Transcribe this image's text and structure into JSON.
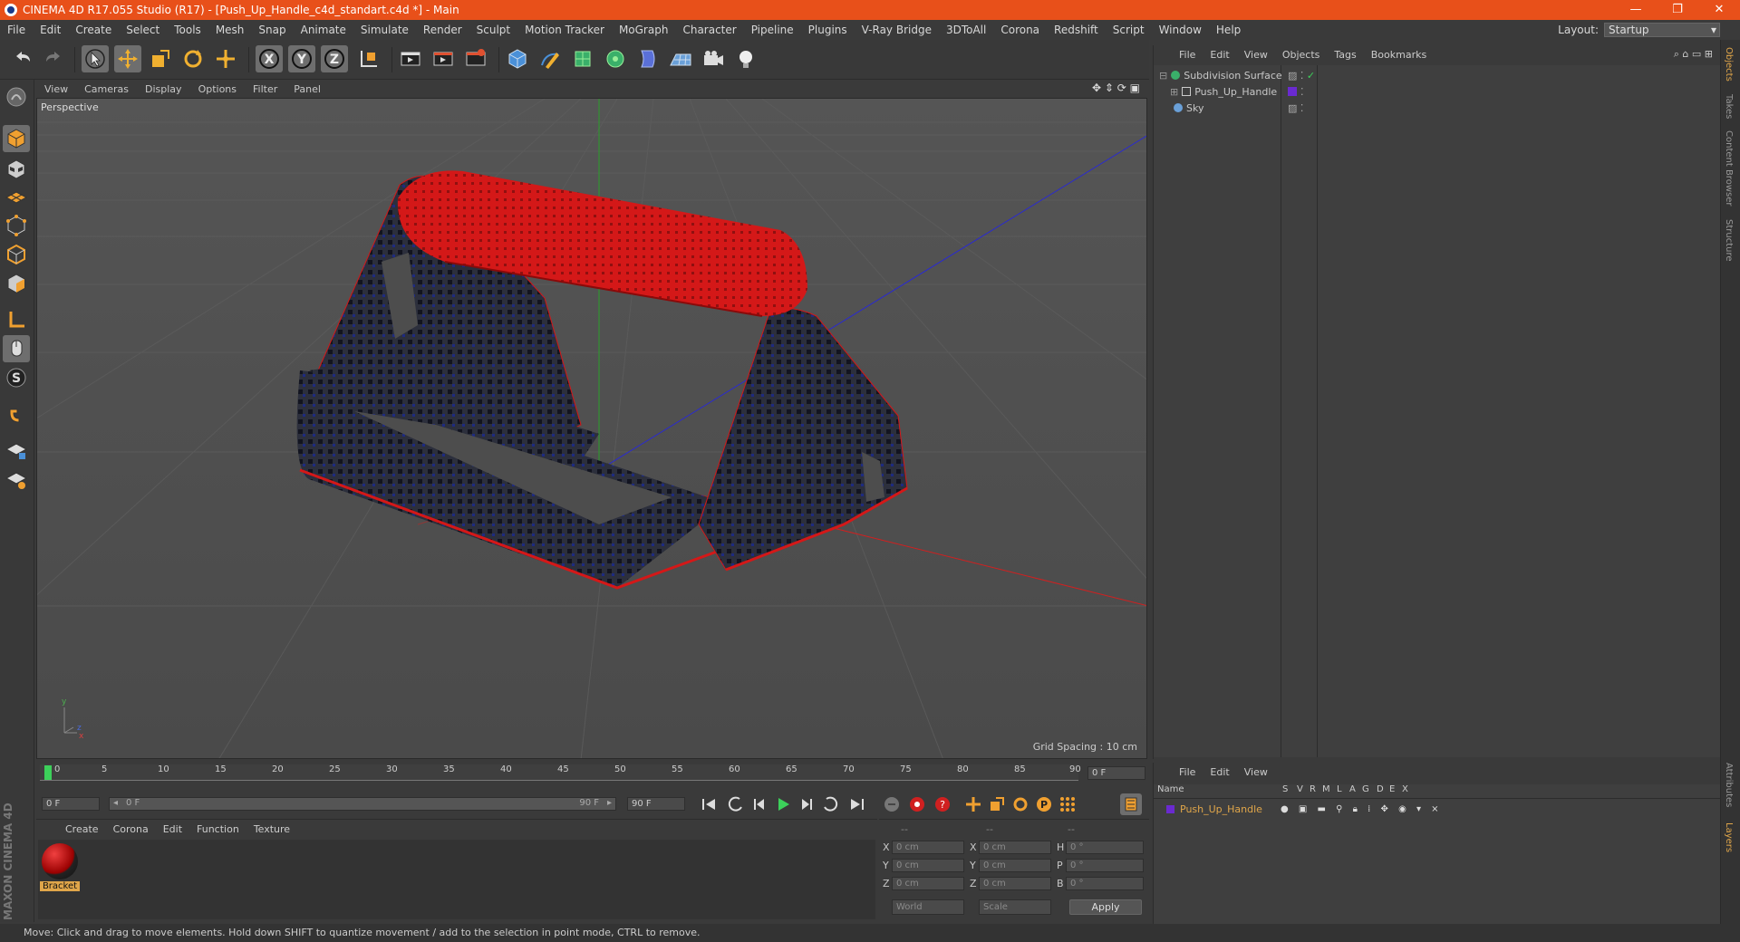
{
  "title": "CINEMA 4D R17.055 Studio (R17) - [Push_Up_Handle_c4d_standart.c4d *] - Main",
  "window_controls": [
    "—",
    "❐",
    "✕"
  ],
  "menu": [
    "File",
    "Edit",
    "Create",
    "Select",
    "Tools",
    "Mesh",
    "Snap",
    "Animate",
    "Simulate",
    "Render",
    "Sculpt",
    "Motion Tracker",
    "MoGraph",
    "Character",
    "Pipeline",
    "Plugins",
    "V-Ray Bridge",
    "3DToAll",
    "Corona",
    "Redshift",
    "Script",
    "Window",
    "Help"
  ],
  "layout": {
    "label": "Layout:",
    "value": "Startup"
  },
  "viewport": {
    "menu": [
      "View",
      "Cameras",
      "Display",
      "Options",
      "Filter",
      "Panel"
    ],
    "label": "Perspective",
    "grid_spacing": "Grid Spacing : 10 cm"
  },
  "timeline": {
    "ticks": [
      "0",
      "5",
      "10",
      "15",
      "20",
      "25",
      "30",
      "35",
      "40",
      "45",
      "50",
      "55",
      "60",
      "65",
      "70",
      "75",
      "80",
      "85",
      "90"
    ],
    "end_frame": "0 F"
  },
  "transport": {
    "start": "0 F",
    "range_start": "0 F",
    "range_end": "90 F",
    "end": "90 F"
  },
  "material_panel": {
    "menu": [
      "Create",
      "Corona",
      "Edit",
      "Function",
      "Texture"
    ],
    "materials": [
      {
        "name": "Bracket"
      }
    ]
  },
  "coord_panel": {
    "headers": [
      "--",
      "--",
      "--"
    ],
    "rows": [
      {
        "a": "X",
        "av": "0 cm",
        "b": "X",
        "bv": "0 cm",
        "c": "H",
        "cv": "0 °"
      },
      {
        "a": "Y",
        "av": "0 cm",
        "b": "Y",
        "bv": "0 cm",
        "c": "P",
        "cv": "0 °"
      },
      {
        "a": "Z",
        "av": "0 cm",
        "b": "Z",
        "bv": "0 cm",
        "c": "B",
        "cv": "0 °"
      }
    ],
    "mode1": "World",
    "mode2": "Scale",
    "apply": "Apply"
  },
  "objects_panel": {
    "menu": [
      "File",
      "Edit",
      "View",
      "Objects",
      "Tags",
      "Bookmarks"
    ],
    "items": [
      {
        "name": "Subdivision Surface",
        "icon": "subdivision-icon"
      },
      {
        "name": "Push_Up_Handle",
        "icon": "null-object-icon"
      },
      {
        "name": "Sky",
        "icon": "sky-icon"
      }
    ]
  },
  "layers_panel": {
    "menu": [
      "File",
      "Edit",
      "View"
    ],
    "columns": [
      "Name",
      "S",
      "V",
      "R",
      "M",
      "L",
      "A",
      "G",
      "D",
      "E",
      "X"
    ],
    "layers": [
      {
        "name": "Push_Up_Handle",
        "color": "#6a2ad0"
      }
    ]
  },
  "side_tabs": [
    "Objects",
    "Takes",
    "Content Browser",
    "Structure"
  ],
  "side_tabs_bottom": [
    "Attributes",
    "Layers"
  ],
  "brand": "MAXON CINEMA 4D",
  "status": "Move: Click and drag to move elements. Hold down SHIFT to quantize movement / add to the selection in point mode, CTRL to remove.",
  "colors": {
    "titlebar": "#e8501a",
    "accent": "#e0a64a",
    "handle_red": "#d41818"
  }
}
